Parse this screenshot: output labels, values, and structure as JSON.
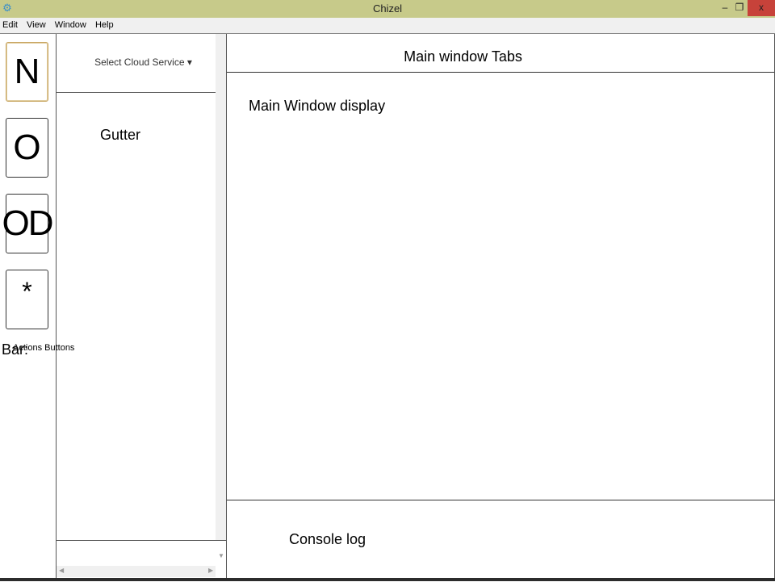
{
  "window": {
    "title": "Chizel",
    "minimize_glyph": "–",
    "maximize_glyph": "❐",
    "close_glyph": "x",
    "app_icon": "gear-icon"
  },
  "menu": {
    "items": [
      "Edit",
      "View",
      "Window",
      "Help"
    ]
  },
  "sidebar": {
    "title": "de Bar:",
    "actions_label": "Actions Buttons",
    "buttons": [
      {
        "label": "N",
        "active": true
      },
      {
        "label": "O",
        "active": false
      },
      {
        "label": "OD",
        "active": false
      },
      {
        "label": "*",
        "active": false
      }
    ]
  },
  "gutter": {
    "service_select": "Select Cloud Service ▾",
    "label": "Gutter"
  },
  "main": {
    "tabs_label": "Main window Tabs",
    "display_label": "Main Window display",
    "console_label": "Console log"
  },
  "colors": {
    "titlebar": "#c7ca8a",
    "close_button": "#c7423a",
    "active_button_border": "#c8a560"
  }
}
